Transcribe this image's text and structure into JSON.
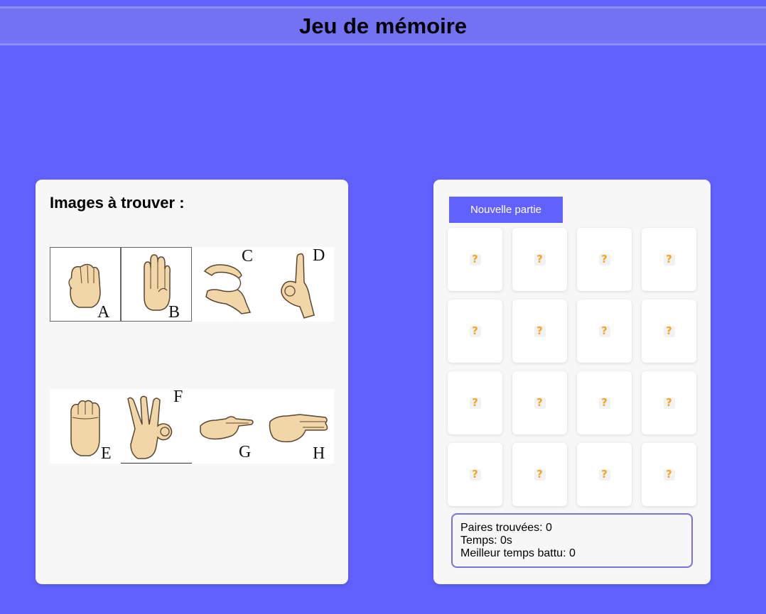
{
  "header": {
    "title": "Jeu de mémoire"
  },
  "signs_panel": {
    "title": "Images à trouver :",
    "signs": [
      {
        "letter": "A",
        "icon": "hand-sign-a-icon"
      },
      {
        "letter": "B",
        "icon": "hand-sign-b-icon"
      },
      {
        "letter": "C",
        "icon": "hand-sign-c-icon"
      },
      {
        "letter": "D",
        "icon": "hand-sign-d-icon"
      },
      {
        "letter": "E",
        "icon": "hand-sign-e-icon"
      },
      {
        "letter": "F",
        "icon": "hand-sign-f-icon"
      },
      {
        "letter": "G",
        "icon": "hand-sign-g-icon"
      },
      {
        "letter": "H",
        "icon": "hand-sign-h-icon"
      }
    ]
  },
  "game_panel": {
    "new_game_label": "Nouvelle partie",
    "card_face": "?",
    "card_icon": "question-mark-icon",
    "stats": {
      "pairs": "Paires trouvées: 0",
      "time": "Temps: 0s",
      "best": "Meilleur temps battu: 0"
    }
  },
  "colors": {
    "background": "#6161ff",
    "header": "#7272f2",
    "panel": "#f7f7f7",
    "accent": "#6161ff",
    "question_mark": "#f5a623",
    "stats_border": "#7a6fe0"
  }
}
